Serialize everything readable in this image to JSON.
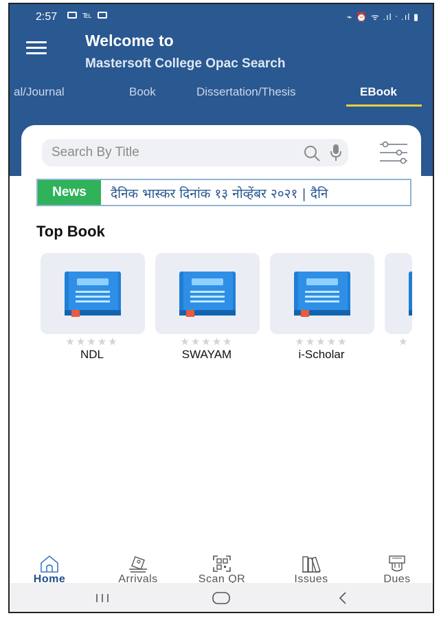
{
  "status_bar": {
    "time": "2:57",
    "right_indicators": "⌁ ⏰ ᯤ .ıl ᐧ .ıl ▮"
  },
  "header": {
    "title": "Welcome to",
    "subtitle": "Mastersoft College Opac Search"
  },
  "tabs": [
    {
      "label": "al/Journal",
      "active": false
    },
    {
      "label": "Book",
      "active": false
    },
    {
      "label": "Dissertation/Thesis",
      "active": false
    },
    {
      "label": "EBook",
      "active": true
    }
  ],
  "search": {
    "placeholder": "Search By Title",
    "value": ""
  },
  "news": {
    "label": "News",
    "text": "दैनिक भास्कर दिनांक १३ नोव्हेंबर २०२१ | दैनि"
  },
  "top_book": {
    "title": "Top Book",
    "books": [
      {
        "label": "NDL",
        "rating": 0
      },
      {
        "label": "SWAYAM",
        "rating": 0
      },
      {
        "label": "i-Scholar",
        "rating": 0
      },
      {
        "label": "",
        "rating": 0
      }
    ]
  },
  "bottom_nav": [
    {
      "label": "Home",
      "icon": "home-icon",
      "active": true
    },
    {
      "label": "Arrivals",
      "icon": "arrivals-icon",
      "active": false
    },
    {
      "label": "Scan QR",
      "icon": "qr-scan-icon",
      "active": false
    },
    {
      "label": "Issues",
      "icon": "books-icon",
      "active": false
    },
    {
      "label": "Dues",
      "icon": "dues-icon",
      "active": false
    }
  ],
  "colors": {
    "header_bg": "#2a5891",
    "tab_underline": "#f3cf3a",
    "news_label_bg": "#2fb25a",
    "book_blue": "#1f7fd6"
  }
}
